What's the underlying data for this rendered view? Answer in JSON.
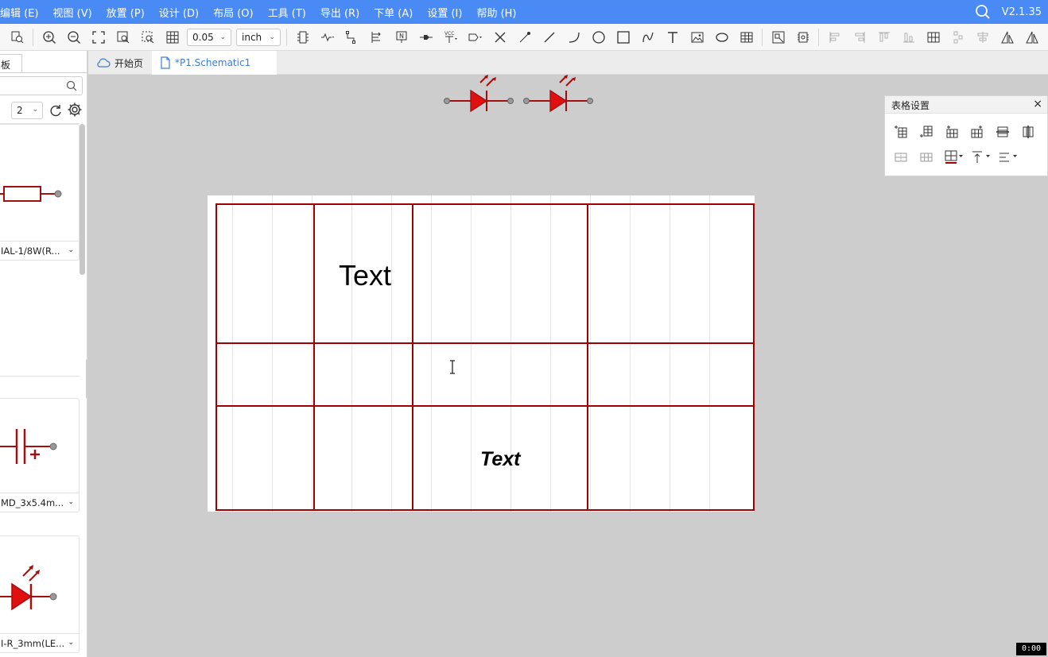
{
  "menu": {
    "items": [
      "编辑 (E)",
      "视图 (V)",
      "放置 (P)",
      "设计 (D)",
      "布局 (O)",
      "工具 (T)",
      "导出 (R)",
      "下单 (A)",
      "设置 (I)",
      "帮助 (H)"
    ],
    "version": "V2.1.35"
  },
  "toolbar": {
    "grid_value": "0.05",
    "unit_value": "inch"
  },
  "left_panel": {
    "tab_label": "板",
    "page_value": "2",
    "cards": [
      {
        "label": "IAL-1/8W(R..."
      },
      {
        "label": "MD_3x5.4m..."
      },
      {
        "label": "I-R_3mm(LE..."
      }
    ]
  },
  "tabs": {
    "home": "开始页",
    "schematic": "*P1.Schematic1"
  },
  "canvas": {
    "cell_text_1": "Text",
    "cell_text_2": "Text",
    "table_border_color": "#a00000"
  },
  "table_settings": {
    "title": "表格设置",
    "close": "×"
  },
  "timer": "0:00"
}
